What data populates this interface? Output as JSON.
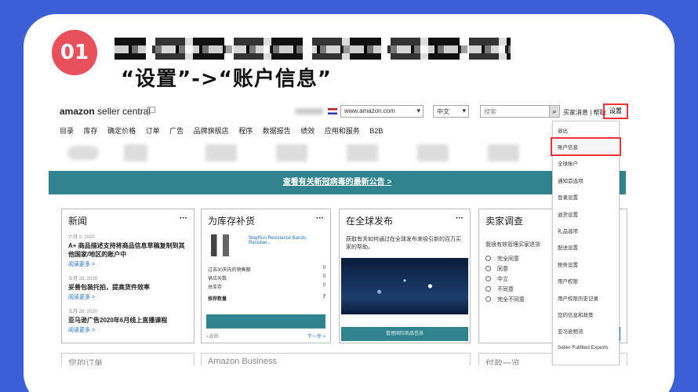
{
  "step": {
    "number": "01"
  },
  "instruction": "“设置”->“账户信息”",
  "seller_central": {
    "logo": {
      "brand": "amazon",
      "product": "seller central"
    },
    "marketplace": "www.amazon.com",
    "language": "中文",
    "search_placeholder": "搜索",
    "top_links": [
      "买家消息",
      "帮助"
    ],
    "settings_label": "设置",
    "nav": [
      "目录",
      "库存",
      "确定价格",
      "订单",
      "广告",
      "品牌旗舰店",
      "程序",
      "数据报告",
      "绩效",
      "应用和服务",
      "B2B"
    ],
    "banner": "查看有关新冠病毒的最新公告 >",
    "panels": {
      "news": {
        "title": "新闻",
        "items": [
          {
            "date": "六月 2, 2020",
            "headline": "A+ 商品描述支持将商品信息草稿复制到其他国家/地区的账户中",
            "link": "阅读更多 >"
          },
          {
            "date": "五月 28, 2020",
            "headline": "妥善包装托拍，提高货件效率",
            "link": "阅读更多 >"
          },
          {
            "date": "五月 28, 2020",
            "headline": "亚马逊广告2020年6月线上直播课程",
            "link": "阅读更多 >"
          }
        ]
      },
      "restock": {
        "title": "为库存补货",
        "product": "WayRun Resistance Bands, Resistan...",
        "rows": [
          {
            "label": "过去30天内的销售额",
            "value": "0"
          },
          {
            "label": "供应天数",
            "value": "0"
          },
          {
            "label": "总库存",
            "value": "0"
          },
          {
            "label": "推荐数量",
            "value": "7"
          }
        ],
        "prev": "<返回",
        "next": "下一步 >"
      },
      "global": {
        "title": "在全球发布",
        "text": "获取有关如何通过在全球发布来吸引新的百万买家的帮助。",
        "button": "管理国际商品信息"
      },
      "survey": {
        "title": "卖家调查",
        "question": "我很有效管理买家退货",
        "options": [
          "完全同意",
          "同意",
          "中立",
          "不同意",
          "完全不同意"
        ],
        "button": "提交"
      }
    },
    "bottom_panels": [
      "您的订单",
      "Amazon Business",
      "付款一览"
    ],
    "settings_menu": [
      "退出",
      "账户信息",
      "全球账户",
      "通知首选项",
      "登录设置",
      "退货设置",
      "礼品选项",
      "配送设置",
      "税务设置",
      "用户权限",
      "用户权限历史记录",
      "您的信息和政策",
      "亚马逊物流",
      "Seller Fulfilled Exports"
    ],
    "highlighted_menu_item": "账户信息"
  },
  "colors": {
    "background": "#3a5fd6",
    "accent": "#e8505b",
    "teal": "#30848f",
    "highlight": "#e33333"
  }
}
